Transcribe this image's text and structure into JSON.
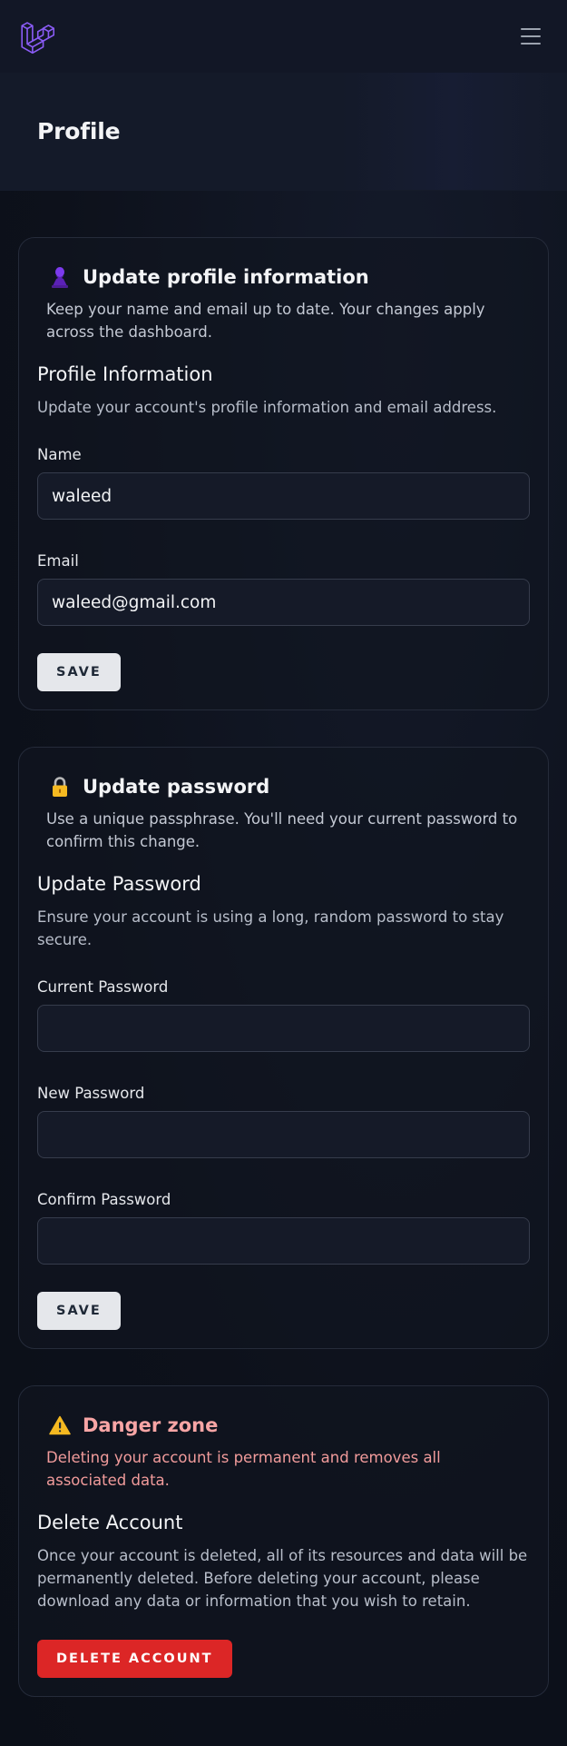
{
  "header": {
    "page_title": "Profile"
  },
  "profile_card": {
    "title": "Update profile information",
    "description": "Keep your name and email up to date. Your changes apply across the dashboard.",
    "section_title": "Profile Information",
    "section_description": "Update your account's profile information and email address.",
    "name_label": "Name",
    "name_value": "waleed",
    "email_label": "Email",
    "email_value": "waleed@gmail.com",
    "save_label": "SAVE",
    "icon": "user-silhouette-icon"
  },
  "password_card": {
    "title": "Update password",
    "description": "Use a unique passphrase. You'll need your current password to confirm this change.",
    "section_title": "Update Password",
    "section_description": "Ensure your account is using a long, random password to stay secure.",
    "current_label": "Current Password",
    "current_value": "",
    "new_label": "New Password",
    "new_value": "",
    "confirm_label": "Confirm Password",
    "confirm_value": "",
    "save_label": "SAVE",
    "icon": "lock-icon"
  },
  "danger_card": {
    "title": "Danger zone",
    "description": "Deleting your account is permanent and removes all associated data.",
    "section_title": "Delete Account",
    "section_description": "Once your account is deleted, all of its resources and data will be permanently deleted. Before deleting your account, please download any data or information that you wish to retain.",
    "delete_label": "DELETE ACCOUNT",
    "icon": "warning-icon"
  },
  "colors": {
    "background": "#0d111b",
    "accent_logo": "#8b5cf6",
    "danger": "#dc2626",
    "danger_text": "#f8a5a5"
  }
}
